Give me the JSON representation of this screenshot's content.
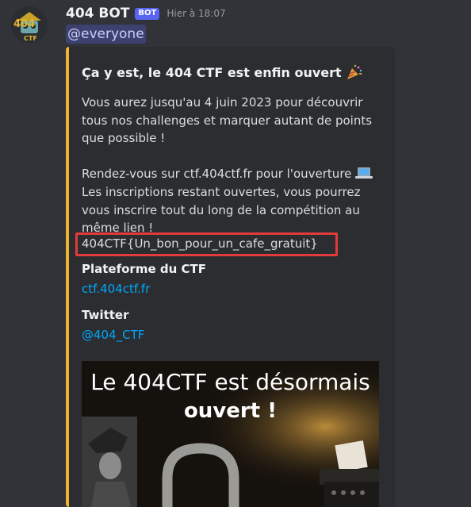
{
  "message": {
    "username": "404 BOT",
    "bot_tag": "BOT",
    "timestamp": "Hier à 18:07",
    "mention": "@everyone",
    "avatar_text": "CTF",
    "avatar_badge": "404"
  },
  "embed": {
    "accent_color": "#f0b232",
    "title": "Ça y est, le 404 CTF est enfin ouvert",
    "title_emoji": "party-popper-icon",
    "description_p1": "Vous aurez jusqu'au 4 juin 2023 pour découvrir tous nos challenges et marquer autant de points que possible !",
    "description_p2": "Rendez-vous sur ctf.404ctf.fr pour l'ouverture",
    "description_p2_emoji": "laptop-icon",
    "description_p3": "Les inscriptions restant ouvertes, vous pourrez vous inscrire tout du long de la compétition au même lien !",
    "flag": "404CTF{Un_bon_pour_un_cafe_gratuit}",
    "fields": [
      {
        "name": "Plateforme du CTF",
        "value": "ctf.404ctf.fr"
      },
      {
        "name": "Twitter",
        "value": "@404_CTF"
      }
    ],
    "image": {
      "line1": "Le 404CTF est désormais",
      "line2": "ouvert !"
    }
  },
  "colors": {
    "background": "#313338",
    "embed_bg": "#2b2d31",
    "link": "#00a8fc",
    "highlight_box": "#e23b3b",
    "bot_tag": "#5865f2"
  }
}
